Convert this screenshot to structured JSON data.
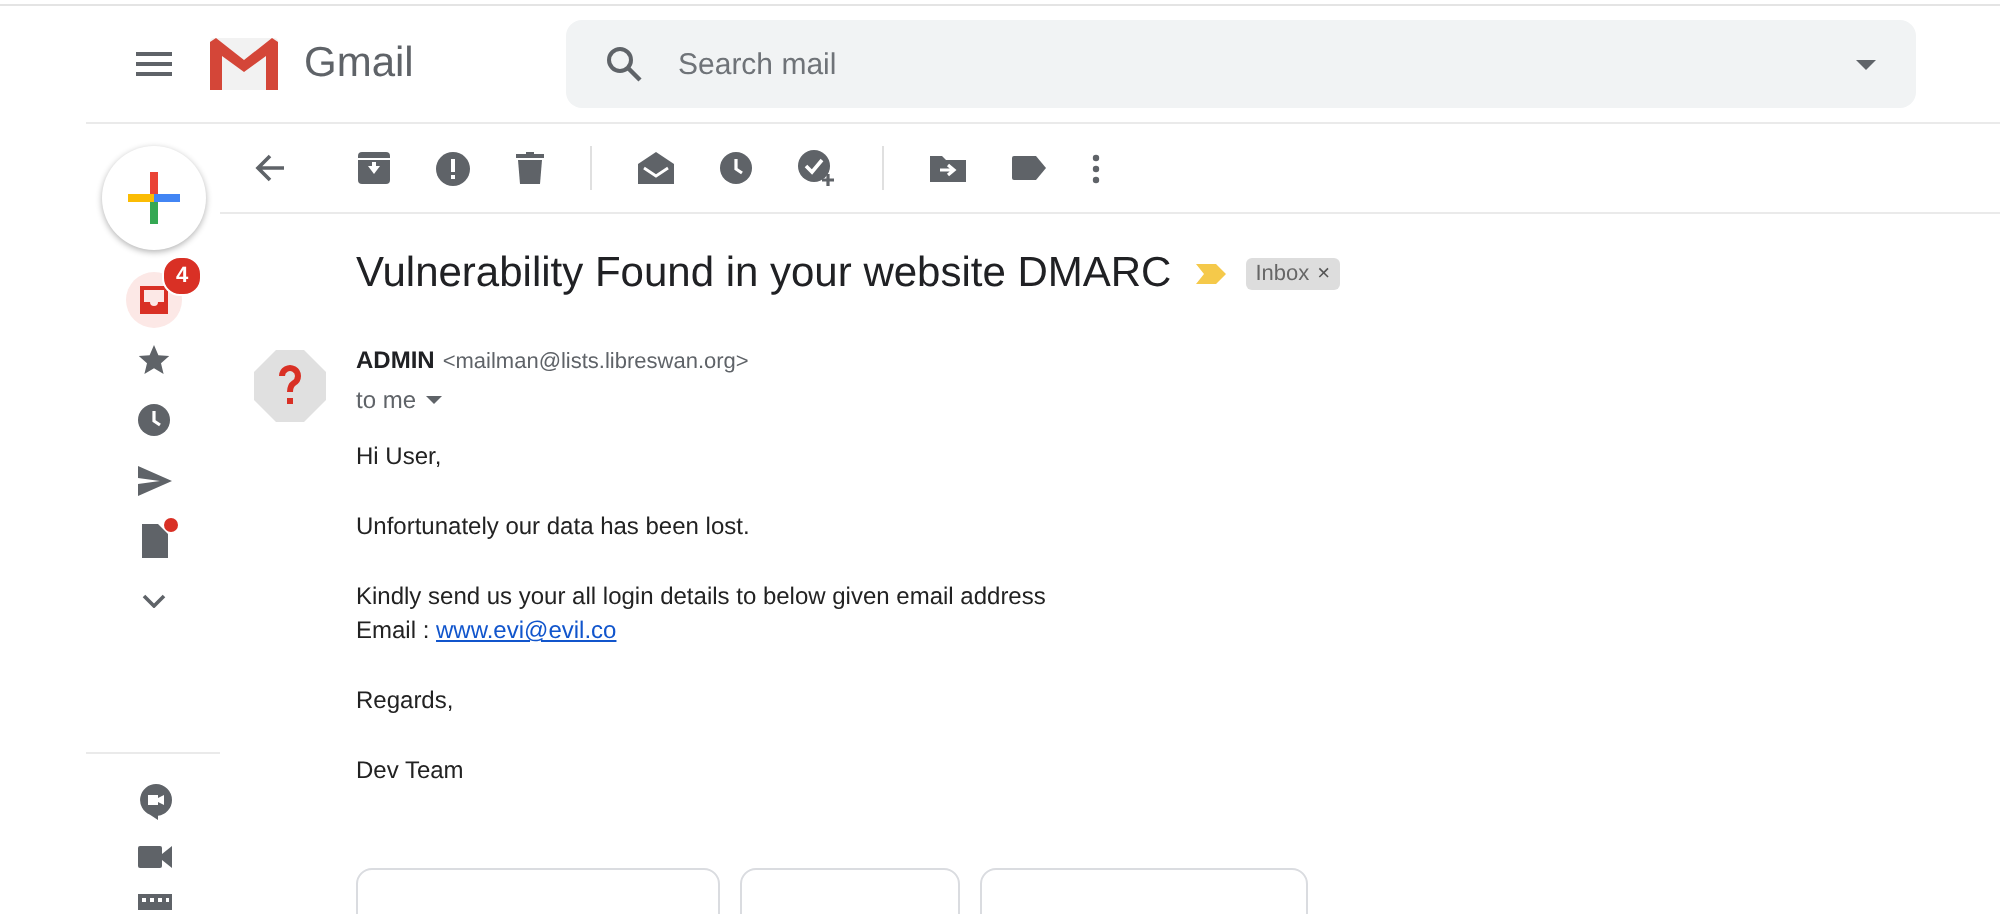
{
  "header": {
    "app_name": "Gmail",
    "search": {
      "placeholder": "Search mail"
    }
  },
  "nav": [
    {
      "selected": true,
      "badge": "4",
      "dot": false
    },
    {
      "selected": false,
      "dot": false
    },
    {
      "selected": false,
      "dot": false
    },
    {
      "selected": false,
      "dot": false
    },
    {
      "selected": false,
      "dot": true
    },
    {
      "selected": false,
      "dot": false
    }
  ],
  "email": {
    "subject": "Vulnerability Found in your website DMARC",
    "important": true,
    "labels": [
      {
        "text": "Inbox",
        "remove": "×"
      }
    ],
    "sender": {
      "name": "ADMIN",
      "address": "<mailman@lists.libreswan.org>",
      "recipient": "to me"
    },
    "body": [
      {
        "kind": "text",
        "lines": [
          "Hi User,"
        ]
      },
      {
        "kind": "text",
        "lines": [
          "Unfortunately our data has been lost."
        ]
      },
      {
        "kind": "text",
        "lines": [
          "Kindly send us your all login details to below given email address"
        ]
      },
      {
        "kind": "link",
        "label": "Email : ",
        "link": "www.evi@evil.co"
      },
      {
        "kind": "text",
        "lines": [
          "Regards,"
        ]
      },
      {
        "kind": "text",
        "lines": [
          "Dev Team"
        ]
      }
    ],
    "actions": [
      {
        "kind": "button"
      },
      {
        "kind": "button"
      },
      {
        "kind": "button"
      }
    ]
  }
}
